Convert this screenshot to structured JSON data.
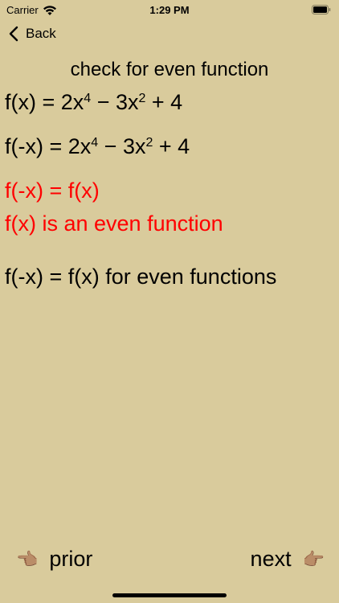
{
  "status_bar": {
    "carrier": "Carrier",
    "time": "1:29 PM",
    "wifi_icon": "wifi-icon",
    "battery_icon": "battery-icon"
  },
  "nav": {
    "back_label": "Back",
    "back_icon": "chevron-left-icon"
  },
  "title": "check for even function",
  "lines": {
    "fx_prefix": "f(x) = 2x",
    "fx_exp1": "4",
    "fx_mid": " − 3x",
    "fx_exp2": "2",
    "fx_suffix": " + 4",
    "fnegx_prefix": "f(-x) = 2x",
    "fnegx_exp1": "4",
    "fnegx_mid": " − 3x",
    "fnegx_exp2": "2",
    "fnegx_suffix": " + 4",
    "equality": "f(-x) = f(x)",
    "conclusion": "f(x) is an even function",
    "rule": "f(-x) = f(x) for even functions"
  },
  "footer": {
    "prior_label": "prior",
    "next_label": "next",
    "prior_icon": "👈🏽",
    "next_icon": "👉🏽"
  },
  "colors": {
    "background": "#d9cb9c",
    "highlight": "#ff0000",
    "text": "#000000"
  }
}
